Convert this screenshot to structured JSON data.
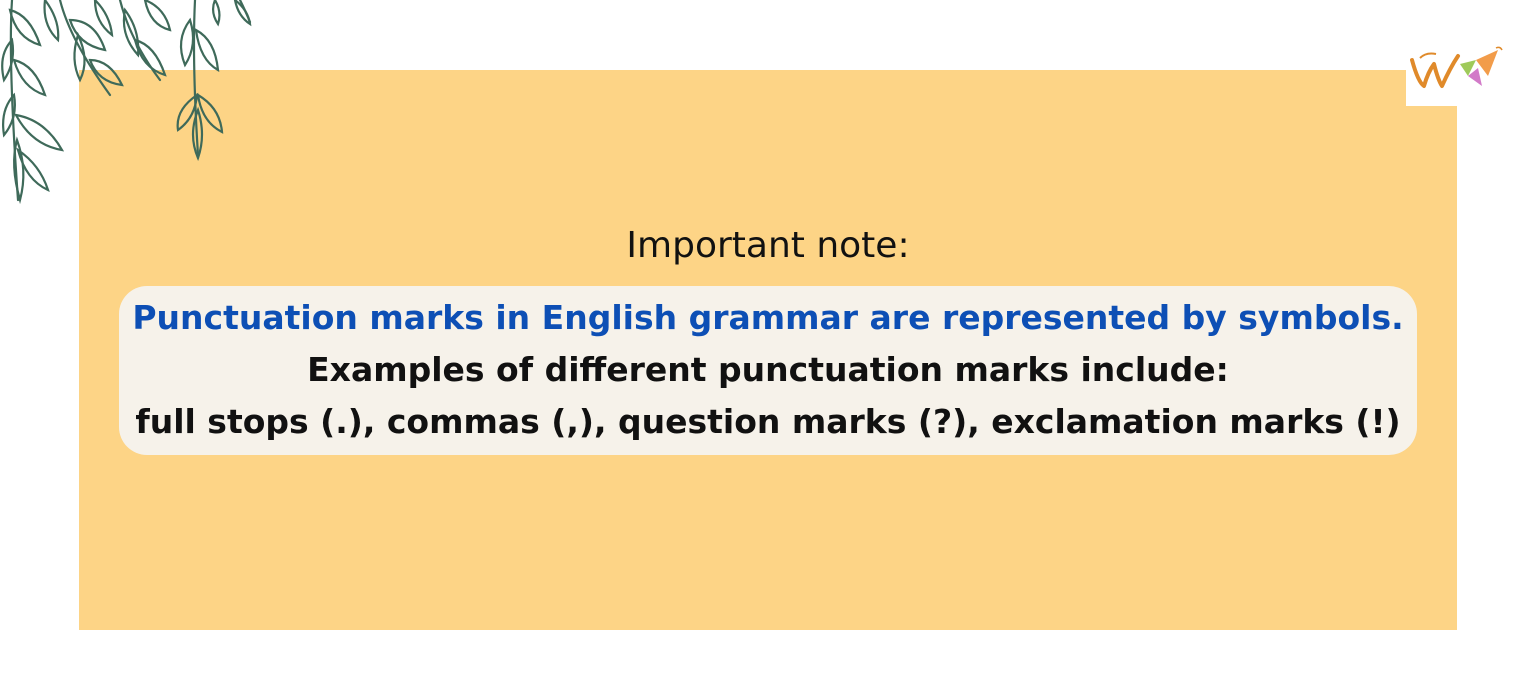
{
  "note": {
    "heading": "Important note:",
    "lines": [
      "Punctuation marks in English grammar are represented by symbols.",
      "Examples of different punctuation marks include:",
      "full stops (.), commas (,), question marks (?), exclamation marks (!)"
    ]
  },
  "colors": {
    "panel": "#fdd486",
    "card": "#f6f2ea",
    "highlight_text": "#0d4fb5",
    "body_text": "#111111",
    "leaf": "#3f6a5a"
  },
  "icons": {
    "leaves": "hanging-leaves-decoration",
    "logo": "w-logo-icon"
  }
}
